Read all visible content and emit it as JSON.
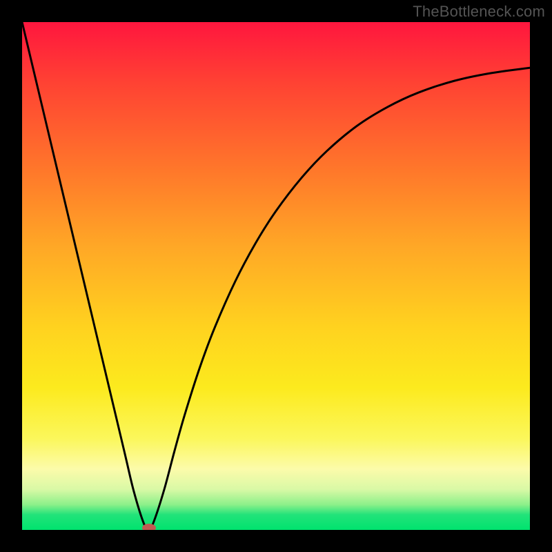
{
  "watermark": "TheBottleneck.com",
  "chart_data": {
    "type": "line",
    "title": "",
    "xlabel": "",
    "ylabel": "",
    "xlim": [
      0,
      100
    ],
    "ylim": [
      0,
      100
    ],
    "grid": false,
    "legend": false,
    "series": [
      {
        "name": "bottleneck-curve",
        "x": [
          0,
          5,
          10,
          15,
          20,
          22,
          24,
          25,
          26,
          28,
          30,
          32,
          35,
          38,
          42,
          46,
          50,
          55,
          60,
          66,
          72,
          78,
          85,
          92,
          100
        ],
        "y": [
          100,
          79,
          58,
          37,
          16,
          7.6,
          1.2,
          0,
          1.8,
          8,
          15.5,
          22.6,
          32,
          40,
          49,
          56.5,
          62.8,
          69.3,
          74.6,
          79.6,
          83.3,
          86.1,
          88.4,
          89.9,
          91
        ]
      }
    ],
    "marker": {
      "x": 25,
      "y": 0,
      "color": "#c05a52",
      "name": "optimal-point"
    }
  },
  "colors": {
    "curve_black": "#000000",
    "marker_fill": "#c05a52",
    "frame_black": "#000000"
  }
}
